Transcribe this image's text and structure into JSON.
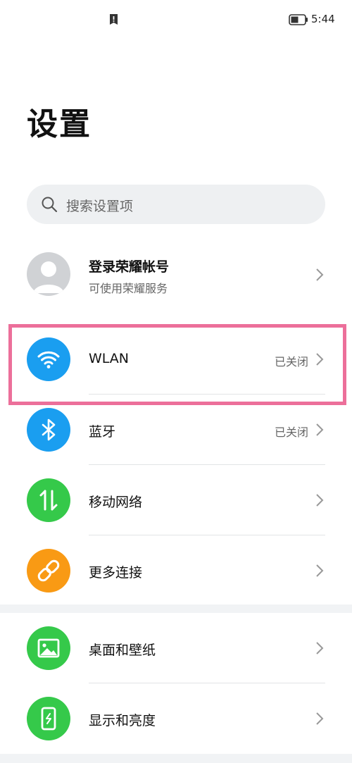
{
  "status_bar": {
    "time": "5:44"
  },
  "page": {
    "title": "设置"
  },
  "search": {
    "placeholder": "搜索设置项"
  },
  "account": {
    "title": "登录荣耀帐号",
    "subtitle": "可使用荣耀服务"
  },
  "settings": {
    "wlan": {
      "label": "WLAN",
      "value": "已关闭",
      "icon": "wifi-icon",
      "color": "#1a9ef0"
    },
    "bluetooth": {
      "label": "蓝牙",
      "value": "已关闭",
      "icon": "bluetooth-icon",
      "color": "#1a9ef0"
    },
    "mobile_network": {
      "label": "移动网络",
      "icon": "mobile-data-icon",
      "color": "#35c94a"
    },
    "more_connections": {
      "label": "更多连接",
      "icon": "link-icon",
      "color": "#f99a14"
    },
    "wallpaper": {
      "label": "桌面和壁纸",
      "icon": "wallpaper-icon",
      "color": "#35c94a"
    },
    "display": {
      "label": "显示和亮度",
      "icon": "display-icon",
      "color": "#35c94a"
    }
  },
  "highlight_color": "#ec6f9a"
}
